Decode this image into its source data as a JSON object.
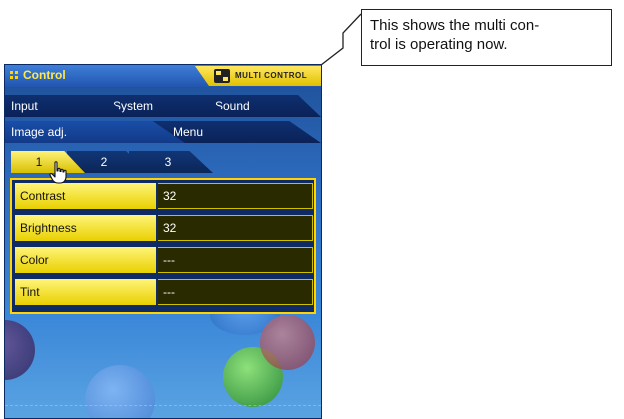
{
  "callout": {
    "line1": "This shows the multi con-",
    "line2": "trol is operating now."
  },
  "window": {
    "title": "Control",
    "status_badge": "MULTI CONTROL"
  },
  "tabs_row1": [
    {
      "label": "Input"
    },
    {
      "label": "System"
    },
    {
      "label": "Sound"
    }
  ],
  "tabs_row2": [
    {
      "label": "Image adj."
    },
    {
      "label": "Menu"
    }
  ],
  "pages": [
    {
      "label": "1",
      "selected": true
    },
    {
      "label": "2",
      "selected": false
    },
    {
      "label": "3",
      "selected": false
    }
  ],
  "settings": [
    {
      "label": "Contrast",
      "value": "32"
    },
    {
      "label": "Brightness",
      "value": "32"
    },
    {
      "label": "Color",
      "value": "---"
    },
    {
      "label": "Tint",
      "value": "---"
    }
  ],
  "colors": {
    "accent": "#ffd400",
    "panel": "#2e6cc0",
    "value_bg": "#2a2a00"
  },
  "icons": {
    "cursor": "hand-pointer-icon",
    "badge": "multi-control-icon"
  }
}
